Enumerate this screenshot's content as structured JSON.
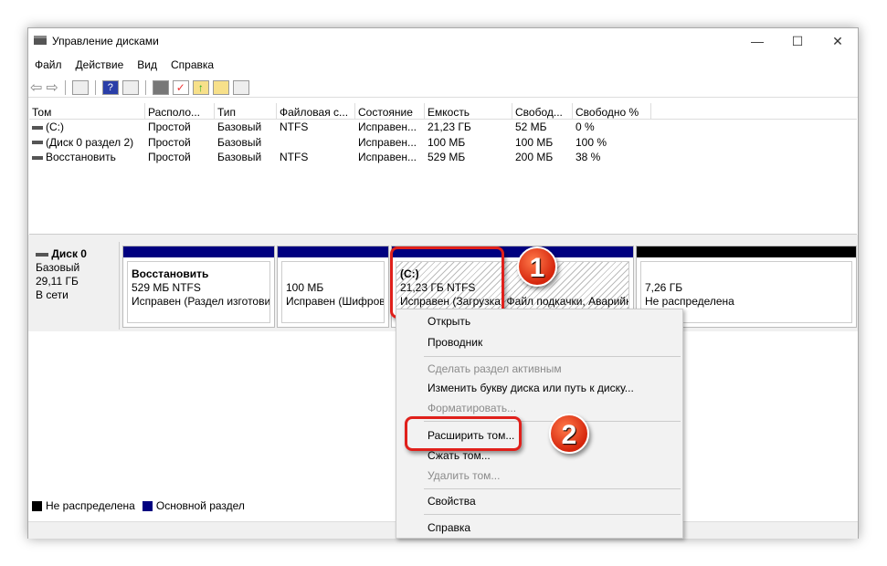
{
  "window": {
    "title": "Управление дисками",
    "minimize": "—",
    "maximize": "☐",
    "close": "✕"
  },
  "menu": [
    "Файл",
    "Действие",
    "Вид",
    "Справка"
  ],
  "toolbar": [
    "back-icon",
    "forward-icon",
    "console-tree-icon",
    "help-icon",
    "action-pane-icon",
    "connect-disk-icon",
    "check-icon",
    "folder-up-icon",
    "folder-search-icon",
    "properties-icon"
  ],
  "table": {
    "headers": [
      "Том",
      "Располо...",
      "Тип",
      "Файловая с...",
      "Состояние",
      "Емкость",
      "Свобод...",
      "Свободно %"
    ],
    "rows": [
      [
        "(C:)",
        "Простой",
        "Базовый",
        "NTFS",
        "Исправен...",
        "21,23 ГБ",
        "52 МБ",
        "0 %"
      ],
      [
        "(Диск 0 раздел 2)",
        "Простой",
        "Базовый",
        "",
        "Исправен...",
        "100 МБ",
        "100 МБ",
        "100 %"
      ],
      [
        "Восстановить",
        "Простой",
        "Базовый",
        "NTFS",
        "Исправен...",
        "529 МБ",
        "200 МБ",
        "38 %"
      ]
    ]
  },
  "disk": {
    "name": "Диск 0",
    "type": "Базовый",
    "size": "29,11 ГБ",
    "status": "В сети",
    "partitions": [
      {
        "name": "Восстановить",
        "size": "529 МБ NTFS",
        "status": "Исправен (Раздел изготовит"
      },
      {
        "name": "",
        "size": "100 МБ",
        "status": "Исправен (Шифров"
      },
      {
        "name": "(C:)",
        "size": "21,23 ГБ NTFS",
        "status": "Исправен (Загрузка, Файл подкачки, Аварийн"
      },
      {
        "name": "",
        "size": "7,26 ГБ",
        "status": "Не распределена"
      }
    ]
  },
  "legend": [
    {
      "label": "Не распределена",
      "color": "#000000"
    },
    {
      "label": "Основной раздел",
      "color": "#000080"
    }
  ],
  "context_menu": [
    {
      "label": "Открыть",
      "enabled": true
    },
    {
      "label": "Проводник",
      "enabled": true
    },
    {
      "label": "Сделать раздел активным",
      "enabled": false
    },
    {
      "label": "Изменить букву диска или путь к диску...",
      "enabled": true
    },
    {
      "label": "Форматировать...",
      "enabled": false
    },
    {
      "label": "Расширить том...",
      "enabled": true
    },
    {
      "label": "Сжать том...",
      "enabled": true
    },
    {
      "label": "Удалить том...",
      "enabled": false
    },
    {
      "label": "Свойства",
      "enabled": true
    },
    {
      "label": "Справка",
      "enabled": true
    }
  ],
  "callouts": [
    "1",
    "2"
  ]
}
